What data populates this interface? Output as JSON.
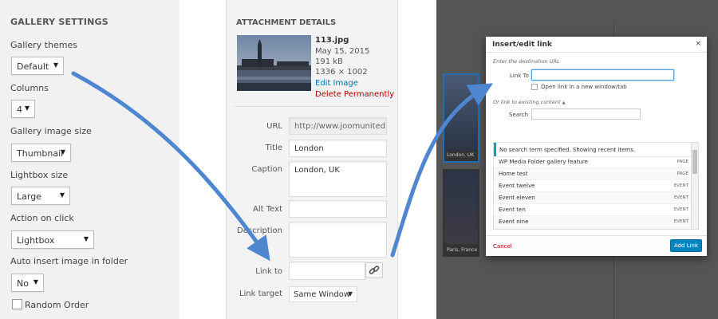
{
  "gallery_settings": {
    "title": "GALLERY SETTINGS",
    "themes": {
      "label": "Gallery themes",
      "value": "Default"
    },
    "columns": {
      "label": "Columns",
      "value": "4"
    },
    "image_size": {
      "label": "Gallery image size",
      "value": "Thumbnail"
    },
    "lightbox_size": {
      "label": "Lightbox size",
      "value": "Large"
    },
    "action_on_click": {
      "label": "Action on click",
      "value": "Lightbox"
    },
    "auto_insert": {
      "label": "Auto insert image in folder",
      "value": "No"
    },
    "random_order": {
      "label": "Random Order"
    }
  },
  "attachment_details": {
    "title": "ATTACHMENT DETAILS",
    "filename": "113.jpg",
    "date": "May 15, 2015",
    "size": "191 kB",
    "dimensions": "1336 × 1002",
    "edit_image": "Edit Image",
    "delete_permanently": "Delete Permanently",
    "fields": {
      "url": {
        "label": "URL",
        "value": "http://www.joomunited.cc"
      },
      "title": {
        "label": "Title",
        "value": "London"
      },
      "caption": {
        "label": "Caption",
        "value": "London, UK"
      },
      "alt_text": {
        "label": "Alt Text",
        "value": ""
      },
      "description": {
        "label": "Description",
        "value": ""
      },
      "link_to": {
        "label": "Link to",
        "value": ""
      },
      "link_target": {
        "label": "Link target",
        "value": "Same Window"
      }
    }
  },
  "background": {
    "caption_london": "London, UK",
    "caption_paris": "Paris, France"
  },
  "insert_link": {
    "title": "Insert/edit link",
    "close": "×",
    "enter_url": "Enter the destination URL",
    "link_to_label": "Link To",
    "new_tab_label": "Open link in a new window/tab",
    "existing_toggle": "Or link to existing content",
    "search_label": "Search",
    "notice": "No search term specified. Showing recent items.",
    "items": [
      {
        "title": "WP Media Folder gallery feature",
        "type": "PAGE"
      },
      {
        "title": "Home test",
        "type": "PAGE"
      },
      {
        "title": "Event twelve",
        "type": "EVENT"
      },
      {
        "title": "Event eleven",
        "type": "EVENT"
      },
      {
        "title": "Event ten",
        "type": "EVENT"
      },
      {
        "title": "Event nine",
        "type": "EVENT"
      }
    ],
    "cancel": "Cancel",
    "add_link": "Add Link"
  },
  "colors": {
    "accent": "#0085ba",
    "arrow": "#4f86d0",
    "danger": "#a00000"
  }
}
